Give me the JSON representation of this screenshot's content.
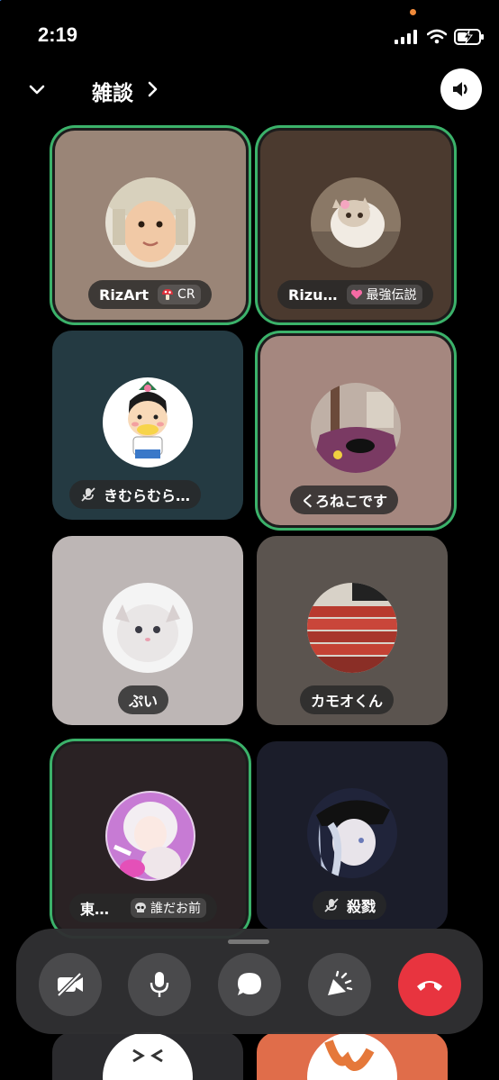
{
  "status_bar": {
    "time": "2:19"
  },
  "header": {
    "title": "雑談"
  },
  "participants": [
    {
      "name": "RizArt",
      "badge": "CR",
      "badge_icon": "mushroom-icon",
      "speaking": true
    },
    {
      "name": "Rizu…",
      "badge": "最強伝説",
      "badge_icon": "heart-icon",
      "speaking": true
    },
    {
      "name": "きむらむら…",
      "muted": true,
      "speaking": false
    },
    {
      "name": "くろねこです",
      "speaking": true
    },
    {
      "name": "ぷい",
      "speaking": false
    },
    {
      "name": "カモオくん",
      "speaking": false
    },
    {
      "name": "東…",
      "badge": "誰だお前",
      "badge_icon": "skull-icon",
      "speaking": true
    },
    {
      "name": "殺戮",
      "muted": true,
      "speaking": false
    }
  ],
  "controls": [
    "camera-off-icon",
    "microphone-icon",
    "chat-bubble-icon",
    "reaction-icon",
    "end-call-icon"
  ],
  "colors": {
    "speaking_ring": "#3bb26a",
    "end_call": "#e8343f"
  }
}
